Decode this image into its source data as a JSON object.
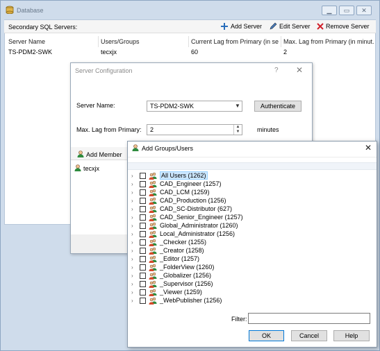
{
  "db_window": {
    "title": "Database",
    "secondary_label": "Secondary SQL Servers:",
    "toolbar": {
      "add_server": "Add Server",
      "edit_server": "Edit Server",
      "remove_server": "Remove Server"
    },
    "columns": [
      "Server Name",
      "Users/Groups",
      "Current Lag from Primary (in se...",
      "Max. Lag from Primary (in minut..."
    ],
    "rows": [
      {
        "server": "TS-PDM2-SWK",
        "users": "tecxjx",
        "current_lag": "60",
        "max_lag": "2"
      }
    ]
  },
  "server_config": {
    "title": "Server Configuration",
    "help": "?",
    "server_name_label": "Server Name:",
    "server_name_value": "TS-PDM2-SWK",
    "authenticate_label": "Authenticate",
    "max_lag_label": "Max. Lag from Primary:",
    "max_lag_value": "2",
    "minutes_label": "minutes",
    "add_member_label": "Add Member",
    "members": [
      "tecxjx"
    ]
  },
  "add_groups": {
    "title": "Add Groups/Users",
    "items": [
      {
        "label": "All Users (1262)",
        "selected": true
      },
      {
        "label": "CAD_Engineer (1257)",
        "selected": false
      },
      {
        "label": "CAD_LCM (1259)",
        "selected": false
      },
      {
        "label": "CAD_Production (1256)",
        "selected": false
      },
      {
        "label": "CAD_SC-Distributor (627)",
        "selected": false
      },
      {
        "label": "CAD_Senior_Engineer (1257)",
        "selected": false
      },
      {
        "label": "Global_Administrator (1260)",
        "selected": false
      },
      {
        "label": "Local_Administrator (1256)",
        "selected": false
      },
      {
        "label": "_Checker (1255)",
        "selected": false
      },
      {
        "label": "_Creator (1258)",
        "selected": false
      },
      {
        "label": "_Editor (1257)",
        "selected": false
      },
      {
        "label": "_FolderView (1260)",
        "selected": false
      },
      {
        "label": "_Globalizer (1256)",
        "selected": false
      },
      {
        "label": "_Supervisor (1256)",
        "selected": false
      },
      {
        "label": "_Viewer (1259)",
        "selected": false
      },
      {
        "label": "_WebPublisher (1256)",
        "selected": false
      }
    ],
    "filter_label": "Filter:",
    "filter_value": "",
    "ok_label": "OK",
    "cancel_label": "Cancel",
    "help_label": "Help"
  },
  "colors": {
    "window_frame": "#cfdceb",
    "selection": "#cde8ff",
    "add_icon": "#2a6ebb",
    "remove_icon": "#d0202a"
  },
  "icons": [
    "database-icon",
    "add-icon",
    "edit-pencil-icon",
    "remove-x-icon",
    "user-icon",
    "group-icon"
  ]
}
